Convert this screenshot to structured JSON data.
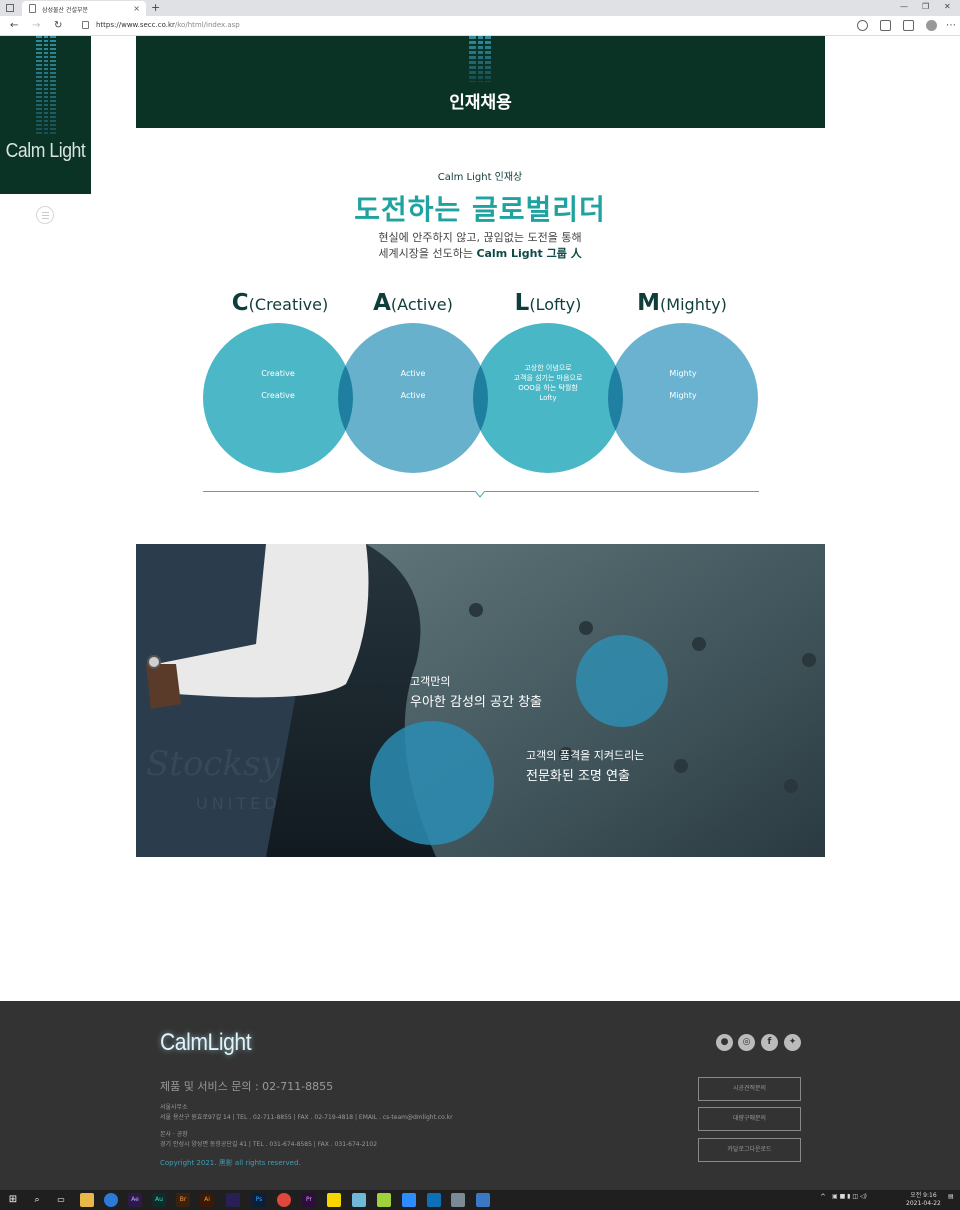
{
  "browser": {
    "tab_title": "삼성물산 건설부문",
    "url_host": "https://www.secc.co.kr",
    "url_path": "/ko/html/index.asp",
    "new_tab": "+",
    "tab_close": "×"
  },
  "logo": {
    "text": "Calm Light"
  },
  "hero": {
    "title": "인재채용"
  },
  "section": {
    "kicker": "Calm Light 인재상",
    "title": "도전하는 글로벌리더",
    "desc_line1": "현실에 안주하지 않고, 끊임없는 도전을 통해",
    "desc_line2_prefix": "세계시장을 선도하는",
    "desc_line2_highlight": "Calm Light 그룹 人"
  },
  "values": [
    {
      "letter": "C",
      "word": "(Creative)",
      "line1": "Creative",
      "line2": "Creative",
      "color": "#42b3c4"
    },
    {
      "letter": "A",
      "word": "(Active)",
      "line1": "Active",
      "line2": "Active",
      "color": "#5fadcb"
    },
    {
      "letter": "L",
      "word": "(Lofty)",
      "multi": [
        "고상한 이념으로",
        "고객을 섬기는 마음으로",
        "OOO을 하는 탁월함",
        "Lofty"
      ],
      "color": "#3fb3c2"
    },
    {
      "letter": "M",
      "word": "(Mighty)",
      "line1": "Mighty",
      "line2": "Mighty",
      "color": "#63aece"
    }
  ],
  "photo": {
    "caption1_line1": "고객만의",
    "caption1_line2": "우아한 감성의 공간 창출",
    "caption2_line1": "고객의 품격을 지켜드리는",
    "caption2_line2": "전문화된 조명 연출",
    "watermark": "Stocksy",
    "watermark_sub": "UNITED"
  },
  "footer": {
    "logo": "CalmLight",
    "phone": "제품 및 서비스 문의 : 02-711-8855",
    "office_label": "서울사무소",
    "office_info": "서울 용산구 원효로97길 14  |  TEL . 02-711-8855  |  FAX . 02-719-4818  |  EMAIL . cs-team@dmlight.co.kr",
    "factory_label": "본사 · 공장",
    "factory_info": "경기 안성시 양성면 동항공단길 41  |  TEL . 031-674-8585  |  FAX . 031-674-2102",
    "copyright": "Copyright 2021. 黑影 all rights reserved.",
    "buttons": [
      "시공견적문의",
      "대량구매문의",
      "카달로그다운로드"
    ],
    "sns": [
      "reddit-icon",
      "instagram-icon",
      "facebook-icon",
      "twitter-icon"
    ]
  },
  "taskbar": {
    "time": "오전 9:16",
    "date": "2021-04-22",
    "apps": [
      "Ae",
      "Au",
      "Br",
      "Ai",
      "Pr",
      "Ps"
    ]
  }
}
